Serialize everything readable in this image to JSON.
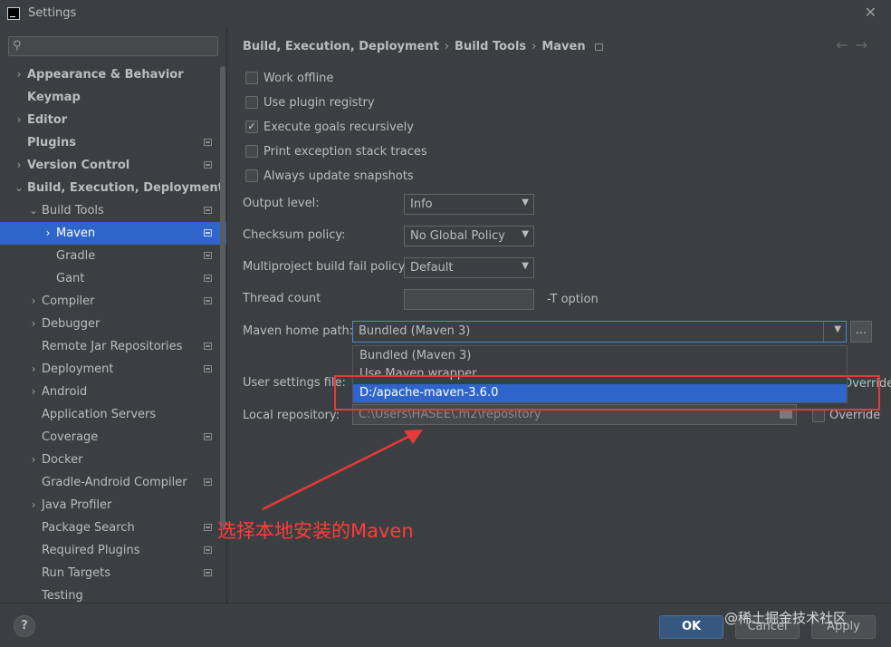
{
  "window": {
    "title": "Settings",
    "close_glyph": "✕"
  },
  "search": {
    "icon": "search-icon",
    "placeholder": ""
  },
  "sidebar": {
    "items": [
      {
        "label": "Appearance & Behavior",
        "level": 0,
        "chevron": "›",
        "bold": true,
        "icon": false
      },
      {
        "label": "Keymap",
        "level": 0,
        "chevron": "",
        "bold": true,
        "icon": false
      },
      {
        "label": "Editor",
        "level": 0,
        "chevron": "›",
        "bold": true,
        "icon": false
      },
      {
        "label": "Plugins",
        "level": 0,
        "chevron": "",
        "bold": true,
        "icon": true
      },
      {
        "label": "Version Control",
        "level": 0,
        "chevron": "›",
        "bold": true,
        "icon": true
      },
      {
        "label": "Build, Execution, Deployment",
        "level": 0,
        "chevron": "⌄",
        "bold": true,
        "icon": false
      },
      {
        "label": "Build Tools",
        "level": 1,
        "chevron": "⌄",
        "bold": false,
        "icon": true
      },
      {
        "label": "Maven",
        "level": 2,
        "chevron": "›",
        "bold": false,
        "icon": true,
        "selected": true
      },
      {
        "label": "Gradle",
        "level": 2,
        "chevron": "",
        "bold": false,
        "icon": true
      },
      {
        "label": "Gant",
        "level": 2,
        "chevron": "",
        "bold": false,
        "icon": true
      },
      {
        "label": "Compiler",
        "level": 1,
        "chevron": "›",
        "bold": false,
        "icon": true
      },
      {
        "label": "Debugger",
        "level": 1,
        "chevron": "›",
        "bold": false,
        "icon": false
      },
      {
        "label": "Remote Jar Repositories",
        "level": 1,
        "chevron": "",
        "bold": false,
        "icon": true
      },
      {
        "label": "Deployment",
        "level": 1,
        "chevron": "›",
        "bold": false,
        "icon": true
      },
      {
        "label": "Android",
        "level": 1,
        "chevron": "›",
        "bold": false,
        "icon": false
      },
      {
        "label": "Application Servers",
        "level": 1,
        "chevron": "",
        "bold": false,
        "icon": false
      },
      {
        "label": "Coverage",
        "level": 1,
        "chevron": "",
        "bold": false,
        "icon": true
      },
      {
        "label": "Docker",
        "level": 1,
        "chevron": "›",
        "bold": false,
        "icon": false
      },
      {
        "label": "Gradle-Android Compiler",
        "level": 1,
        "chevron": "",
        "bold": false,
        "icon": true
      },
      {
        "label": "Java Profiler",
        "level": 1,
        "chevron": "›",
        "bold": false,
        "icon": false
      },
      {
        "label": "Package Search",
        "level": 1,
        "chevron": "",
        "bold": false,
        "icon": true
      },
      {
        "label": "Required Plugins",
        "level": 1,
        "chevron": "",
        "bold": false,
        "icon": true
      },
      {
        "label": "Run Targets",
        "level": 1,
        "chevron": "",
        "bold": false,
        "icon": true
      },
      {
        "label": "Testing",
        "level": 1,
        "chevron": "",
        "bold": false,
        "icon": false
      }
    ]
  },
  "breadcrumb": {
    "parts": [
      "Build, Execution, Deployment",
      "Build Tools",
      "Maven"
    ],
    "separator": "›",
    "back_glyph": "←",
    "forward_glyph": "→"
  },
  "checkboxes": [
    {
      "label": "Work offline",
      "checked": false
    },
    {
      "label": "Use plugin registry",
      "checked": false
    },
    {
      "label": "Execute goals recursively",
      "checked": true
    },
    {
      "label": "Print exception stack traces",
      "checked": false
    },
    {
      "label": "Always update snapshots",
      "checked": false
    }
  ],
  "check_glyph": "✓",
  "form": {
    "output_level": {
      "label": "Output level:",
      "value": "Info"
    },
    "checksum_policy": {
      "label": "Checksum policy:",
      "value": "No Global Policy"
    },
    "multiproject_fail": {
      "label": "Multiproject build fail policy:",
      "value": "Default"
    },
    "thread_count": {
      "label": "Thread count",
      "value": "",
      "hint": "-T option"
    },
    "maven_home": {
      "label": "Maven home path:",
      "value": "Bundled (Maven 3)",
      "browse_label": "..."
    },
    "user_settings": {
      "label": "User settings file:",
      "override_label": "Override"
    },
    "local_repo": {
      "label": "Local repository:",
      "value": "C:\\Users\\HASEE\\.m2\\repository",
      "override_label": "Override"
    },
    "dropdown_arrow": "▼"
  },
  "maven_dropdown": {
    "options": [
      "Bundled (Maven 3)",
      "Use Maven wrapper",
      "D:/apache-maven-3.6.0"
    ],
    "selected_index": 2
  },
  "annotation": {
    "text": "选择本地安装的Maven",
    "color": "#e53a3a"
  },
  "footer": {
    "help_label": "?",
    "ok_label": "OK",
    "cancel_label": "Cancel",
    "apply_label": "Apply"
  },
  "watermark": "@稀土掘金技术社区",
  "colors": {
    "background": "#3c3f41",
    "selection": "#2f65ca",
    "primary_button": "#365880",
    "text": "#bbbbbb"
  }
}
